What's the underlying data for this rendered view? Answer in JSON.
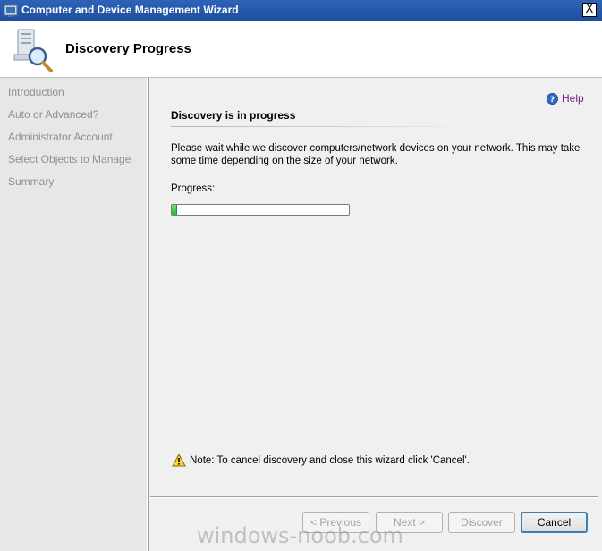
{
  "window": {
    "title": "Computer and Device Management Wizard",
    "close_label": "X"
  },
  "header": {
    "title": "Discovery Progress",
    "icon": "computer-magnifier-icon"
  },
  "sidebar": {
    "steps": [
      {
        "label": "Introduction"
      },
      {
        "label": "Auto or Advanced?"
      },
      {
        "label": "Administrator Account"
      },
      {
        "label": "Select Objects to Manage"
      },
      {
        "label": "Summary"
      }
    ]
  },
  "main": {
    "help_label": "Help",
    "section_title": "Discovery is in progress",
    "description": "Please wait while we discover computers/network devices on your network. This may take some time depending on the size of your network.",
    "progress_label": "Progress:",
    "progress_fraction": 0.03,
    "note": "Note: To cancel discovery and close this wizard click 'Cancel'."
  },
  "buttons": {
    "previous": "< Previous",
    "next": "Next >",
    "discover": "Discover",
    "cancel": "Cancel"
  },
  "watermark": "windows-noob.com",
  "colors": {
    "titlebar": "#2d63b8",
    "help_link": "#7a1e82",
    "progress": "#2ab53a"
  }
}
